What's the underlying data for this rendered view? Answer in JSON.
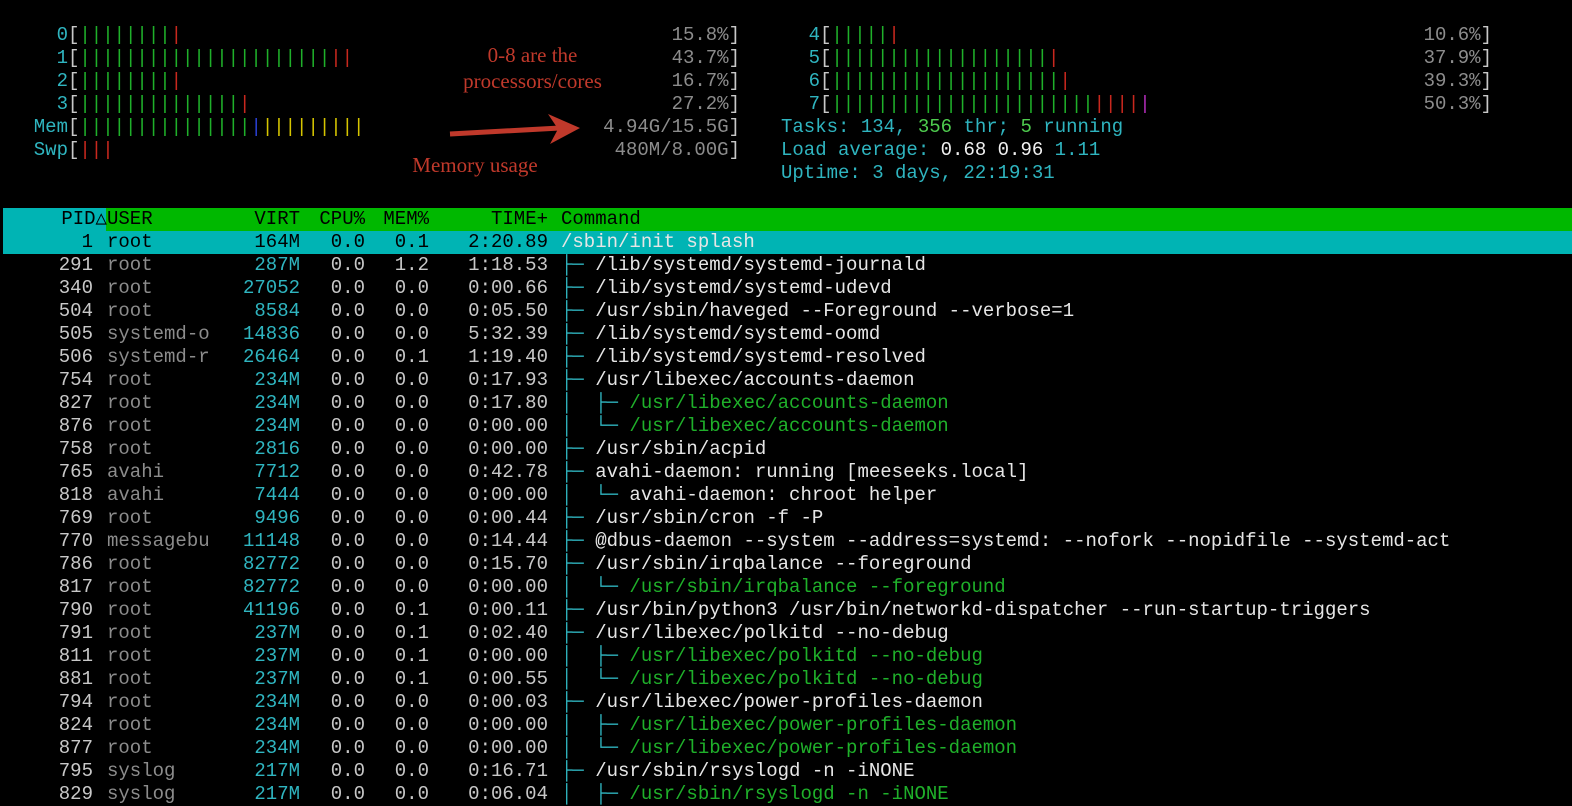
{
  "cpus_left": [
    {
      "label": "0",
      "bars": [
        {
          "c": "g",
          "n": 8
        },
        {
          "c": "r",
          "n": 1
        }
      ],
      "pct": "15.8%"
    },
    {
      "label": "1",
      "bars": [
        {
          "c": "g",
          "n": 22
        },
        {
          "c": "r",
          "n": 2
        }
      ],
      "pct": "43.7%"
    },
    {
      "label": "2",
      "bars": [
        {
          "c": "g",
          "n": 8
        },
        {
          "c": "r",
          "n": 1
        }
      ],
      "pct": "16.7%"
    },
    {
      "label": "3",
      "bars": [
        {
          "c": "g",
          "n": 14
        },
        {
          "c": "r",
          "n": 1
        }
      ],
      "pct": "27.2%"
    }
  ],
  "cpus_right": [
    {
      "label": "4",
      "bars": [
        {
          "c": "g",
          "n": 5
        },
        {
          "c": "r",
          "n": 1
        }
      ],
      "pct": "10.6%"
    },
    {
      "label": "5",
      "bars": [
        {
          "c": "g",
          "n": 19
        },
        {
          "c": "r",
          "n": 1
        }
      ],
      "pct": "37.9%"
    },
    {
      "label": "6",
      "bars": [
        {
          "c": "g",
          "n": 20
        },
        {
          "c": "r",
          "n": 1
        }
      ],
      "pct": "39.3%"
    },
    {
      "label": "7",
      "bars": [
        {
          "c": "g",
          "n": 23
        },
        {
          "c": "r",
          "n": 4
        },
        {
          "c": "m",
          "n": 1
        }
      ],
      "pct": "50.3%"
    }
  ],
  "mem": {
    "label": "Mem",
    "bars": [
      {
        "c": "g",
        "n": 15
      },
      {
        "c": "b",
        "n": 1
      },
      {
        "c": "y",
        "n": 9
      }
    ],
    "value": "4.94G/15.5G"
  },
  "swp": {
    "label": "Swp",
    "bars": [
      {
        "c": "r",
        "n": 3
      }
    ],
    "value": "480M/8.00G"
  },
  "tasks": {
    "label": "Tasks: ",
    "count": "134",
    "sep1": ", ",
    "thr": "356",
    "thr_label": " thr; ",
    "running": "5",
    "running_label": " running"
  },
  "load": {
    "label": "Load average: ",
    "one": "0.68",
    "five": "0.96",
    "fifteen": "1.11"
  },
  "uptime": {
    "label": "Uptime: ",
    "value": "3 days, 22:19:31"
  },
  "annotations": {
    "cores": "0-8 are the\nprocessors/cores",
    "memory": "Memory usage"
  },
  "header": {
    "pid": "PID△",
    "user": "USER",
    "virt": "VIRT",
    "cpu": "CPU%",
    "mem": "MEM%",
    "time": "TIME+",
    "command": "Command"
  },
  "processes": [
    {
      "pid": "1",
      "user": "root",
      "virt": "164M",
      "cpu": "0.0",
      "mem": "0.1",
      "time": "2:20.89",
      "tree": "",
      "cmd": "/sbin/init splash",
      "thread": false,
      "selected": true
    },
    {
      "pid": "291",
      "user": "root",
      "virt": "287M",
      "cpu": "0.0",
      "mem": "1.2",
      "time": "1:18.53",
      "tree": "├─ ",
      "cmd": "/lib/systemd/systemd-journald",
      "thread": false
    },
    {
      "pid": "340",
      "user": "root",
      "virt": "27052",
      "cpu": "0.0",
      "mem": "0.0",
      "time": "0:00.66",
      "tree": "├─ ",
      "cmd": "/lib/systemd/systemd-udevd",
      "thread": false
    },
    {
      "pid": "504",
      "user": "root",
      "virt": "8584",
      "cpu": "0.0",
      "mem": "0.0",
      "time": "0:05.50",
      "tree": "├─ ",
      "cmd": "/usr/sbin/haveged --Foreground --verbose=1",
      "thread": false
    },
    {
      "pid": "505",
      "user": "systemd-o",
      "virt": "14836",
      "cpu": "0.0",
      "mem": "0.0",
      "time": "5:32.39",
      "tree": "├─ ",
      "cmd": "/lib/systemd/systemd-oomd",
      "thread": false
    },
    {
      "pid": "506",
      "user": "systemd-r",
      "virt": "26464",
      "cpu": "0.0",
      "mem": "0.1",
      "time": "1:19.40",
      "tree": "├─ ",
      "cmd": "/lib/systemd/systemd-resolved",
      "thread": false
    },
    {
      "pid": "754",
      "user": "root",
      "virt": "234M",
      "cpu": "0.0",
      "mem": "0.0",
      "time": "0:17.93",
      "tree": "├─ ",
      "cmd": "/usr/libexec/accounts-daemon",
      "thread": false
    },
    {
      "pid": "827",
      "user": "root",
      "virt": "234M",
      "cpu": "0.0",
      "mem": "0.0",
      "time": "0:17.80",
      "tree": "│  ├─ ",
      "cmd": "/usr/libexec/accounts-daemon",
      "thread": true
    },
    {
      "pid": "876",
      "user": "root",
      "virt": "234M",
      "cpu": "0.0",
      "mem": "0.0",
      "time": "0:00.00",
      "tree": "│  └─ ",
      "cmd": "/usr/libexec/accounts-daemon",
      "thread": true
    },
    {
      "pid": "758",
      "user": "root",
      "virt": "2816",
      "cpu": "0.0",
      "mem": "0.0",
      "time": "0:00.00",
      "tree": "├─ ",
      "cmd": "/usr/sbin/acpid",
      "thread": false
    },
    {
      "pid": "765",
      "user": "avahi",
      "virt": "7712",
      "cpu": "0.0",
      "mem": "0.0",
      "time": "0:42.78",
      "tree": "├─ ",
      "cmd": "avahi-daemon: running [meeseeks.local]",
      "thread": false
    },
    {
      "pid": "818",
      "user": "avahi",
      "virt": "7444",
      "cpu": "0.0",
      "mem": "0.0",
      "time": "0:00.00",
      "tree": "│  └─ ",
      "cmd": "avahi-daemon: chroot helper",
      "thread": false
    },
    {
      "pid": "769",
      "user": "root",
      "virt": "9496",
      "cpu": "0.0",
      "mem": "0.0",
      "time": "0:00.44",
      "tree": "├─ ",
      "cmd": "/usr/sbin/cron -f -P",
      "thread": false
    },
    {
      "pid": "770",
      "user": "messagebu",
      "virt": "11148",
      "cpu": "0.0",
      "mem": "0.0",
      "time": "0:14.44",
      "tree": "├─ ",
      "cmd": "@dbus-daemon --system --address=systemd: --nofork --nopidfile --systemd-act",
      "thread": false
    },
    {
      "pid": "786",
      "user": "root",
      "virt": "82772",
      "cpu": "0.0",
      "mem": "0.0",
      "time": "0:15.70",
      "tree": "├─ ",
      "cmd": "/usr/sbin/irqbalance --foreground",
      "thread": false
    },
    {
      "pid": "817",
      "user": "root",
      "virt": "82772",
      "cpu": "0.0",
      "mem": "0.0",
      "time": "0:00.00",
      "tree": "│  └─ ",
      "cmd": "/usr/sbin/irqbalance --foreground",
      "thread": true
    },
    {
      "pid": "790",
      "user": "root",
      "virt": "41196",
      "cpu": "0.0",
      "mem": "0.1",
      "time": "0:00.11",
      "tree": "├─ ",
      "cmd": "/usr/bin/python3 /usr/bin/networkd-dispatcher --run-startup-triggers",
      "thread": false
    },
    {
      "pid": "791",
      "user": "root",
      "virt": "237M",
      "cpu": "0.0",
      "mem": "0.1",
      "time": "0:02.40",
      "tree": "├─ ",
      "cmd": "/usr/libexec/polkitd --no-debug",
      "thread": false
    },
    {
      "pid": "811",
      "user": "root",
      "virt": "237M",
      "cpu": "0.0",
      "mem": "0.1",
      "time": "0:00.00",
      "tree": "│  ├─ ",
      "cmd": "/usr/libexec/polkitd --no-debug",
      "thread": true
    },
    {
      "pid": "881",
      "user": "root",
      "virt": "237M",
      "cpu": "0.0",
      "mem": "0.1",
      "time": "0:00.55",
      "tree": "│  └─ ",
      "cmd": "/usr/libexec/polkitd --no-debug",
      "thread": true
    },
    {
      "pid": "794",
      "user": "root",
      "virt": "234M",
      "cpu": "0.0",
      "mem": "0.0",
      "time": "0:00.03",
      "tree": "├─ ",
      "cmd": "/usr/libexec/power-profiles-daemon",
      "thread": false
    },
    {
      "pid": "824",
      "user": "root",
      "virt": "234M",
      "cpu": "0.0",
      "mem": "0.0",
      "time": "0:00.00",
      "tree": "│  ├─ ",
      "cmd": "/usr/libexec/power-profiles-daemon",
      "thread": true
    },
    {
      "pid": "877",
      "user": "root",
      "virt": "234M",
      "cpu": "0.0",
      "mem": "0.0",
      "time": "0:00.00",
      "tree": "│  └─ ",
      "cmd": "/usr/libexec/power-profiles-daemon",
      "thread": true
    },
    {
      "pid": "795",
      "user": "syslog",
      "virt": "217M",
      "cpu": "0.0",
      "mem": "0.0",
      "time": "0:16.71",
      "tree": "├─ ",
      "cmd": "/usr/sbin/rsyslogd -n -iNONE",
      "thread": false
    },
    {
      "pid": "829",
      "user": "syslog",
      "virt": "217M",
      "cpu": "0.0",
      "mem": "0.0",
      "time": "0:06.04",
      "tree": "│  ├─ ",
      "cmd": "/usr/sbin/rsyslogd -n -iNONE",
      "thread": true
    }
  ]
}
